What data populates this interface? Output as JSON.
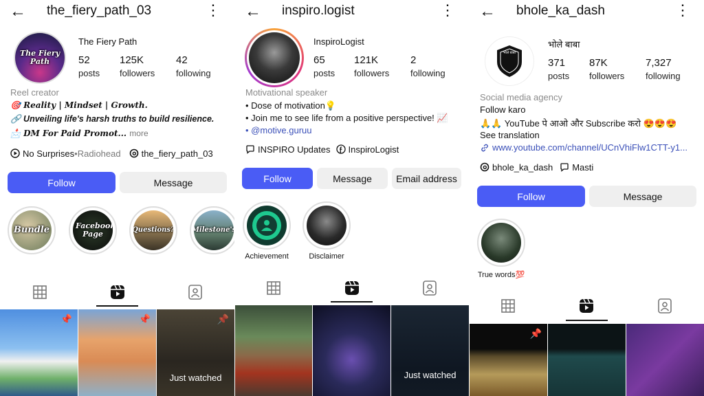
{
  "profiles": [
    {
      "username": "the_fiery_path_03",
      "display_name": "The Fiery Path",
      "avatar_text": "The Fiery Path",
      "stats": [
        {
          "num": "52",
          "label": "posts"
        },
        {
          "num": "125K",
          "label": "followers"
        },
        {
          "num": "42",
          "label": "following"
        }
      ],
      "category": "Reel creator",
      "bio": [
        "🎯 Reality | Mindset | Growth.",
        "🔗 Unveiling life's harsh truths to build resilience.",
        "📩 DM For Paid Promot..."
      ],
      "more": "more",
      "music_title": "No Surprises",
      "music_sep": " • ",
      "music_artist": "Radiohead",
      "threads_handle": "the_fiery_path_03",
      "buttons": {
        "follow": "Follow",
        "message": "Message"
      },
      "highlights": [
        "Bundle",
        "Facebook Page",
        "Questions?",
        "Milestone's"
      ],
      "tiles": [
        {
          "text": ""
        },
        {
          "text": ""
        },
        {
          "text": "Just watched"
        }
      ]
    },
    {
      "username": "inspiro.logist",
      "display_name": "InspiroLogist",
      "stats": [
        {
          "num": "65",
          "label": "posts"
        },
        {
          "num": "121K",
          "label": "followers"
        },
        {
          "num": "2",
          "label": "following"
        }
      ],
      "category": "Motivational speaker",
      "bio": [
        "• Dose of motivation💡",
        "• Join me to see life from a positive perspective! 📈",
        "• @motive.guruu"
      ],
      "channel_name": "INSPIRO Updates",
      "facebook_name": "InspiroLogist",
      "buttons": {
        "follow": "Follow",
        "message": "Message",
        "email": "Email address"
      },
      "highlights": [
        "Achievement",
        "Disclaimer"
      ],
      "tiles": [
        {
          "text": ""
        },
        {
          "text": ""
        },
        {
          "text": "Just watched"
        }
      ]
    },
    {
      "username": "bhole_ka_dash",
      "display_name": "भोले बाबा",
      "avatar_text": "भोले बाबा",
      "stats": [
        {
          "num": "371",
          "label": "posts"
        },
        {
          "num": "87K",
          "label": "followers"
        },
        {
          "num": "7,327",
          "label": "following"
        }
      ],
      "category": "Social media agency",
      "bio": [
        "Follow karo",
        "🙏🙏 YouTube पे आओ और Subscribe करो 😍😍😍"
      ],
      "see_translation": "See translation",
      "url": "www.youtube.com/channel/UCnVhiFlw1CTT-y1...",
      "threads_handle": "bhole_ka_dash",
      "channel_name": "Masti",
      "buttons": {
        "follow": "Follow",
        "message": "Message"
      },
      "highlights": [
        "True words💯"
      ],
      "tiles": [
        {
          "text": ""
        },
        {
          "text": ""
        },
        {
          "text": ""
        }
      ]
    }
  ],
  "icons": {
    "back": "←",
    "kebab": "⋮",
    "link": "🔗",
    "pin": "📌"
  }
}
